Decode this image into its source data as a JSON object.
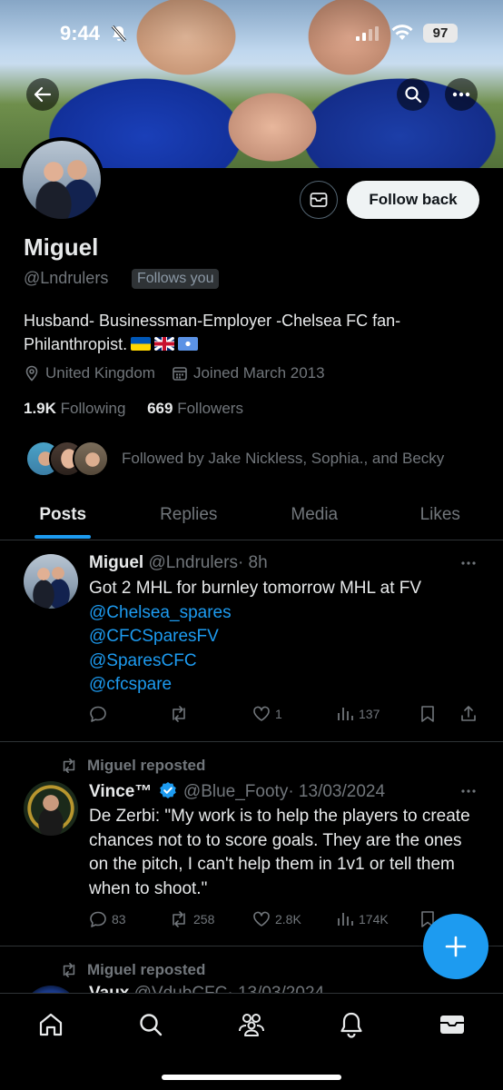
{
  "status_bar": {
    "time": "9:44",
    "battery": "97"
  },
  "profile": {
    "name": "Miguel",
    "handle": "@Lndrulers",
    "follows_you": "Follows you",
    "follow_back_label": "Follow back",
    "bio": "Husband- Businessman-Employer -Chelsea FC fan-Philanthropist.",
    "bio_flags": [
      "ukraine-flag",
      "uk-flag",
      "un-flag"
    ],
    "location": "United Kingdom",
    "joined": "Joined March 2013",
    "following_count": "1.9K",
    "following_label": "Following",
    "followers_count": "669",
    "followers_label": "Followers",
    "followed_by": "Followed by Jake Nickless, Sophia., and Becky"
  },
  "tabs": [
    {
      "label": "Posts",
      "active": true
    },
    {
      "label": "Replies",
      "active": false
    },
    {
      "label": "Media",
      "active": false
    },
    {
      "label": "Likes",
      "active": false
    }
  ],
  "posts": [
    {
      "author": "Miguel",
      "handle": "@Lndrulers",
      "time": "· 8h",
      "text": "Got 2 MHL for burnley tomorrow MHL at FV",
      "mentions": [
        "@Chelsea_spares",
        "@CFCSparesFV",
        "@SparesCFC",
        "@cfcspare"
      ],
      "replies": "",
      "reposts": "",
      "likes": "1",
      "views": "137"
    },
    {
      "reposted_by": "Miguel reposted",
      "author": "Vince™",
      "handle": "@Blue_Footy",
      "time": "· 13/03/2024",
      "text": "De Zerbi: \"My work is to help the players to create chances not to to score goals. They are the ones on the pitch, I can't help them in 1v1 or tell them when to shoot.\"",
      "replies": "83",
      "reposts": "258",
      "likes": "2.8K",
      "views": "174K"
    },
    {
      "reposted_by": "Miguel reposted",
      "author": "Vaux",
      "handle": "@VdubCFC",
      "time": "· 13/03/2024"
    }
  ],
  "colors": {
    "accent": "#1d9bf0",
    "background": "#000000",
    "muted": "#71767b"
  }
}
